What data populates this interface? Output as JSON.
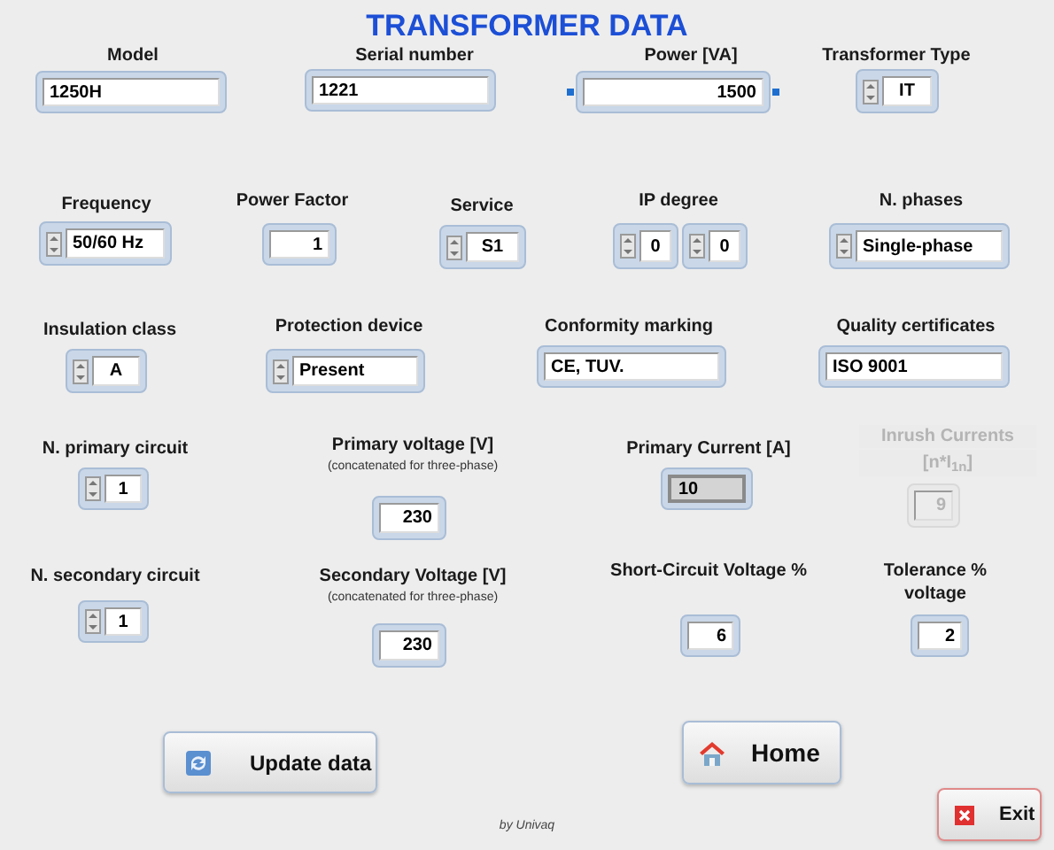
{
  "title": "TRANSFORMER DATA",
  "controls": [
    {
      "kind": "text",
      "label": "Model",
      "value": "1250H",
      "selected": false,
      "disabled": false
    },
    {
      "kind": "text",
      "label": "Serial number",
      "value": "1221",
      "selected": false,
      "disabled": false
    },
    {
      "kind": "numeric",
      "label": "Power [VA]",
      "value": "1500",
      "selected": true,
      "disabled": false
    },
    {
      "kind": "ring",
      "label": "Transformer Type",
      "value": "IT",
      "selected": false,
      "disabled": false
    },
    {
      "kind": "ring",
      "label": "Frequency",
      "value": "50/60 Hz",
      "selected": false,
      "disabled": false
    },
    {
      "kind": "numeric",
      "label": "Power Factor",
      "value": "1",
      "selected": false,
      "disabled": false
    },
    {
      "kind": "ring",
      "label": "Service",
      "value": "S1",
      "selected": false,
      "disabled": false
    },
    {
      "kind": "ring_pair",
      "label": "IP degree",
      "values": [
        "0",
        "0"
      ],
      "selected": false,
      "disabled": false
    },
    {
      "kind": "ring",
      "label": "N. phases",
      "value": "Single-phase",
      "selected": false,
      "disabled": false
    },
    {
      "kind": "ring",
      "label": "Insulation class",
      "value": "A",
      "selected": false,
      "disabled": false
    },
    {
      "kind": "ring",
      "label": "Protection device",
      "value": "Present",
      "selected": false,
      "disabled": false
    },
    {
      "kind": "text",
      "label": "Conformity marking",
      "value": "CE, TUV.",
      "selected": false,
      "disabled": false
    },
    {
      "kind": "text",
      "label": "Quality certificates",
      "value": "ISO 9001",
      "selected": false,
      "disabled": false
    },
    {
      "kind": "ring",
      "label": "N. primary circuit",
      "value": "1",
      "selected": false,
      "disabled": false
    },
    {
      "kind": "numeric",
      "label": "Primary voltage [V]",
      "sublabel": "(concatenated for three-phase)",
      "value": "230",
      "selected": false,
      "disabled": false
    },
    {
      "kind": "indicator",
      "label": "Primary Current [A]",
      "value": "10",
      "selected": false,
      "disabled": false
    },
    {
      "kind": "numeric",
      "label": "Inrush Currents",
      "sublabel": "[n*I$_{1n}$]",
      "value": "9",
      "selected": false,
      "disabled": true
    },
    {
      "kind": "ring",
      "label": "N. secondary circuit",
      "value": "1",
      "selected": false,
      "disabled": false
    },
    {
      "kind": "numeric",
      "label": "Secondary Voltage [V]",
      "sublabel": "(concatenated for three-phase)",
      "value": "230",
      "selected": false,
      "disabled": false
    },
    {
      "kind": "numeric",
      "label": "Short-Circuit Voltage %",
      "value": "6",
      "selected": false,
      "disabled": false
    },
    {
      "kind": "numeric",
      "label": "Tolerance % voltage",
      "value": "2",
      "selected": false,
      "disabled": false
    }
  ],
  "buttons": [
    {
      "kind": "update",
      "label": "Update data"
    },
    {
      "kind": "home",
      "label": "Home"
    },
    {
      "kind": "exit",
      "label": "Exit"
    }
  ],
  "footer": "by Univaq"
}
